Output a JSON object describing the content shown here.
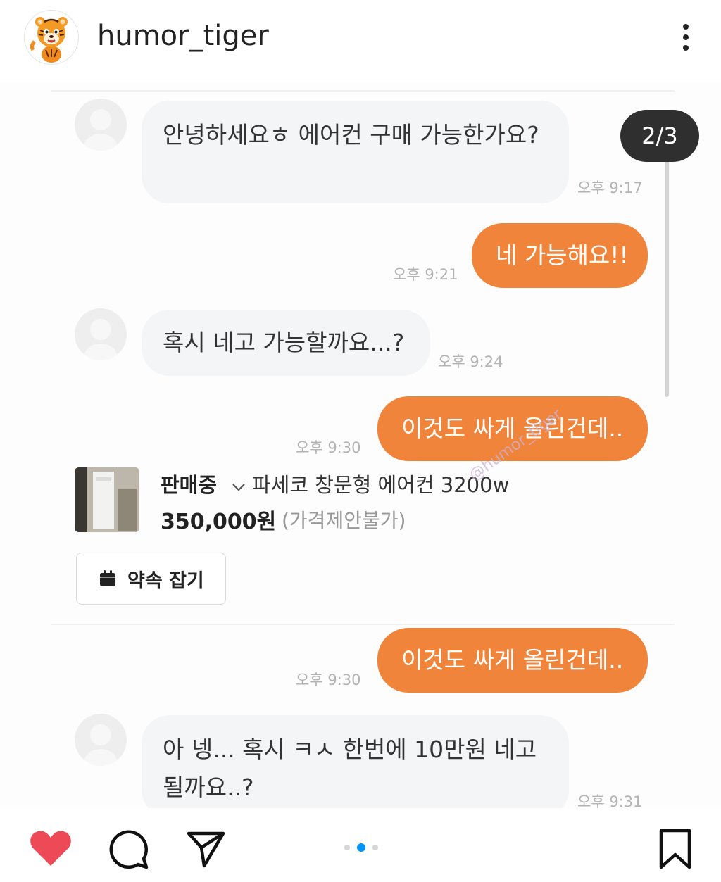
{
  "post": {
    "username": "humor_tiger",
    "more_icon": "more-vertical-icon"
  },
  "image": {
    "counter": "2/3",
    "watermark": "@humor_tiger",
    "messages": [
      {
        "side": "in",
        "text": "안녕하세요ㅎ 에어컨 구매 가능한가요?",
        "time": "오후 9:17"
      },
      {
        "side": "out",
        "text": "네 가능해요!!",
        "time": "오후 9:21"
      },
      {
        "side": "in",
        "text": "혹시 네고 가능할까요...?",
        "time": "오후 9:24"
      },
      {
        "side": "out",
        "text": "이것도 싸게 올린건데..",
        "time": "오후 9:30"
      },
      {
        "side": "out",
        "text": "이것도 싸게 올린건데..",
        "time": "오후 9:30"
      },
      {
        "side": "in",
        "text": "아 넹... 혹시 ㅋㅅ 한번에 10만원 네고될까요..?",
        "time": "오후 9:31"
      }
    ],
    "product": {
      "status": "판매중",
      "name": "파세코 창문형 에어컨 3200w",
      "price": "350,000원",
      "price_note": "(가격제안불가)",
      "appointment_button": "약속 잡기"
    }
  },
  "actions": {
    "like_color": "#ed4956",
    "carousel_total": 3,
    "carousel_active": 2
  }
}
